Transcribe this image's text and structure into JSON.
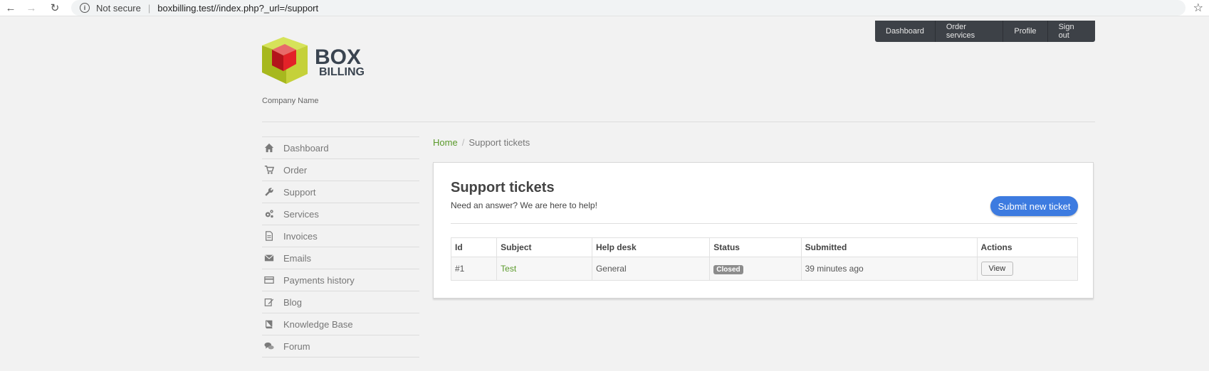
{
  "browser": {
    "not_secure": "Not secure",
    "url": "boxbilling.test//index.php?_url=/support"
  },
  "topmenu": {
    "items": [
      "Dashboard",
      "Order services",
      "Profile",
      "Sign out"
    ]
  },
  "header": {
    "company_name": "Company Name",
    "logo_text_top": "BOX",
    "logo_text_bottom": "BILLING"
  },
  "sidebar": {
    "items": [
      {
        "label": "Dashboard",
        "icon": "home-icon"
      },
      {
        "label": "Order",
        "icon": "cart-icon"
      },
      {
        "label": "Support",
        "icon": "wrench-icon"
      },
      {
        "label": "Services",
        "icon": "gears-icon"
      },
      {
        "label": "Invoices",
        "icon": "document-icon"
      },
      {
        "label": "Emails",
        "icon": "envelope-icon"
      },
      {
        "label": "Payments history",
        "icon": "credit-card-icon"
      },
      {
        "label": "Blog",
        "icon": "edit-icon"
      },
      {
        "label": "Knowledge Base",
        "icon": "book-icon"
      },
      {
        "label": "Forum",
        "icon": "comments-icon"
      }
    ]
  },
  "breadcrumb": {
    "home": "Home",
    "separator": "/",
    "current": "Support tickets"
  },
  "main": {
    "title": "Support tickets",
    "subtitle": "Need an answer? We are here to help!",
    "submit_button": "Submit new ticket",
    "table": {
      "headers": [
        "Id",
        "Subject",
        "Help desk",
        "Status",
        "Submitted",
        "Actions"
      ],
      "rows": [
        {
          "id": "#1",
          "subject": "Test",
          "help_desk": "General",
          "status": "Closed",
          "submitted": "39 minutes ago",
          "action": "View"
        }
      ]
    }
  },
  "colors": {
    "accent_green": "#5a9a2a",
    "button_blue": "#3d7be0",
    "topmenu_bg": "#3d4147"
  }
}
